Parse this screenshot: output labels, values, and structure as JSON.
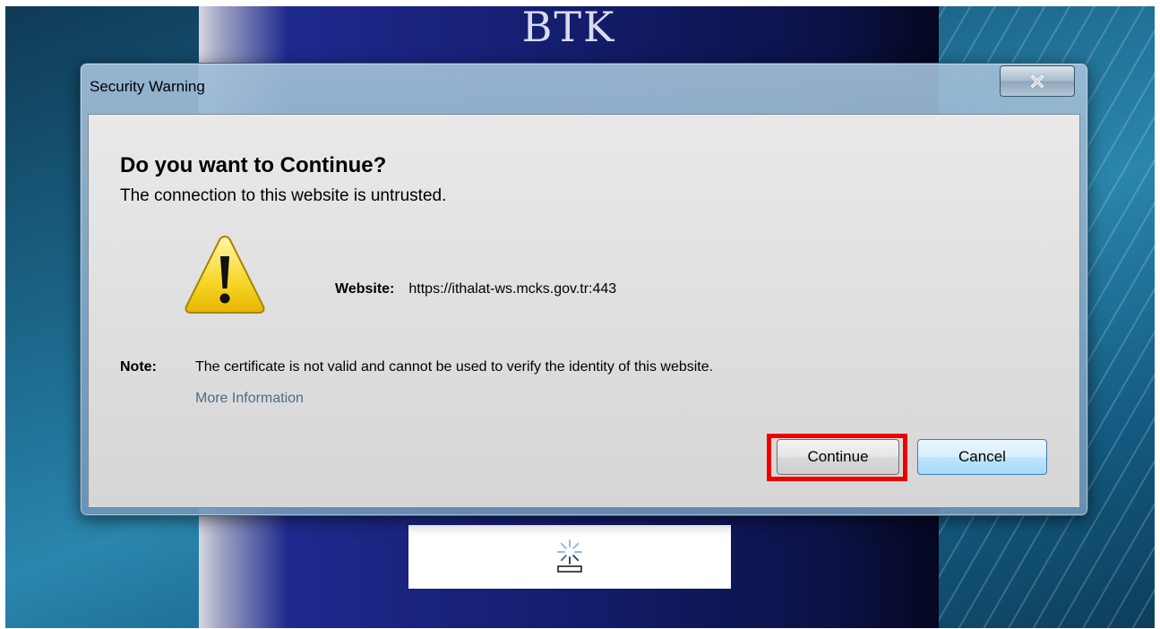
{
  "background": {
    "splash_title": "BTK",
    "loader_icon": "loading-spinner-icon"
  },
  "dialog": {
    "title": "Security Warning",
    "close_icon": "close-icon",
    "headline": "Do you want to Continue?",
    "subline": "The connection to this website is untrusted.",
    "warning_icon": "warning-triangle-icon",
    "website_label": "Website:",
    "website_url": "https://ithalat-ws.mcks.gov.tr:443",
    "note_label": "Note:",
    "note_text": "The certificate is not valid and cannot be used to verify the identity of this website.",
    "more_info_link": "More Information",
    "buttons": {
      "continue_label": "Continue",
      "cancel_label": "Cancel"
    },
    "highlight_color": "#ee0000"
  }
}
